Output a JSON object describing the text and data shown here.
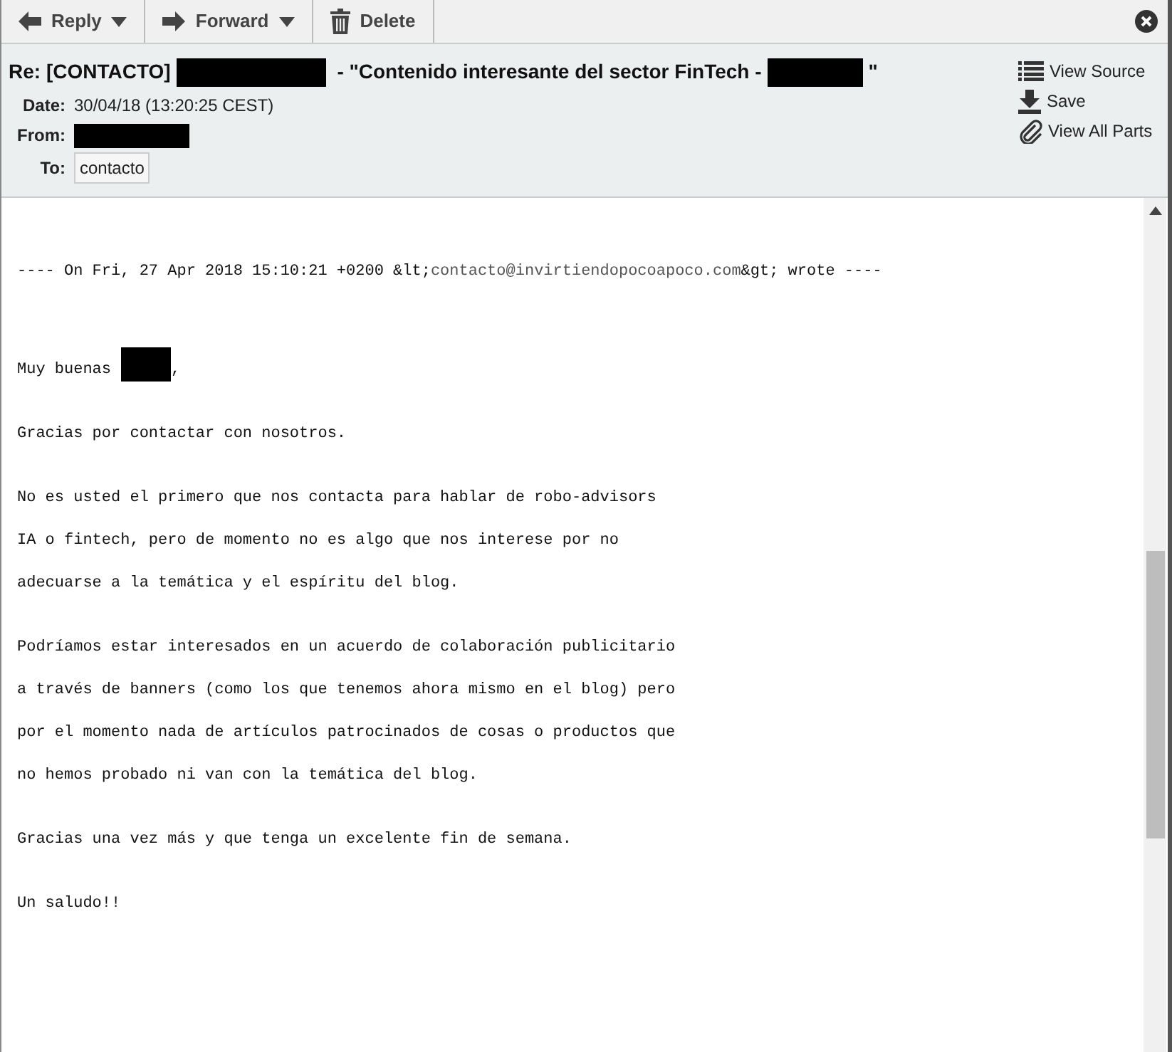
{
  "toolbar": {
    "buttons": [
      {
        "label": "Reply",
        "kind": "reply",
        "dropdown": true
      },
      {
        "label": "Forward",
        "kind": "forward",
        "dropdown": true
      },
      {
        "label": "Delete",
        "kind": "delete",
        "dropdown": false
      }
    ]
  },
  "header": {
    "subject": [
      "Re: [CONTACTO]",
      " - \"Contenido interesante del sector FinTech -",
      "\""
    ],
    "fields": [
      {
        "label": "Date:",
        "kind": "text",
        "value": "30/04/18 (13:20:25 CEST)"
      },
      {
        "label": "From:",
        "kind": "redacted"
      },
      {
        "label": "To:",
        "kind": "chip",
        "value": "contacto"
      }
    ],
    "actions": [
      {
        "label": "View Source",
        "kind": "list"
      },
      {
        "label": "Save",
        "kind": "download"
      },
      {
        "label": "View All Parts",
        "kind": "paperclip"
      }
    ]
  },
  "body": [
    {
      "kind": "quote",
      "prefix": "---- On Fri, 27 Apr 2018 15:10:21 +0200 &lt;",
      "link": "contacto@invirtiendopocoapoco.com",
      "suffix": "&gt; wrote ----"
    },
    {
      "kind": "greeting",
      "prefix": "Muy buenas",
      "suffix": ","
    },
    {
      "kind": "lines",
      "lines": [
        "Gracias por contactar con nosotros."
      ]
    },
    {
      "kind": "lines",
      "lines": [
        "No es usted el primero que nos contacta para hablar de robo-advisors",
        "IA o fintech, pero de momento no es algo que nos interese por no",
        "adecuarse a la temática y el espíritu del blog."
      ]
    },
    {
      "kind": "lines",
      "lines": [
        "Podríamos estar interesados en un acuerdo de colaboración publicitario",
        "a través de banners (como los que tenemos ahora mismo en el blog) pero",
        "por el momento nada de artículos patrocinados de cosas o productos que",
        "no hemos probado ni van con la temática del blog."
      ]
    },
    {
      "kind": "lines",
      "lines": [
        "Gracias una vez más y que tenga un excelente fin de semana."
      ]
    },
    {
      "kind": "lines",
      "lines": [
        "Un saludo!!"
      ]
    }
  ]
}
